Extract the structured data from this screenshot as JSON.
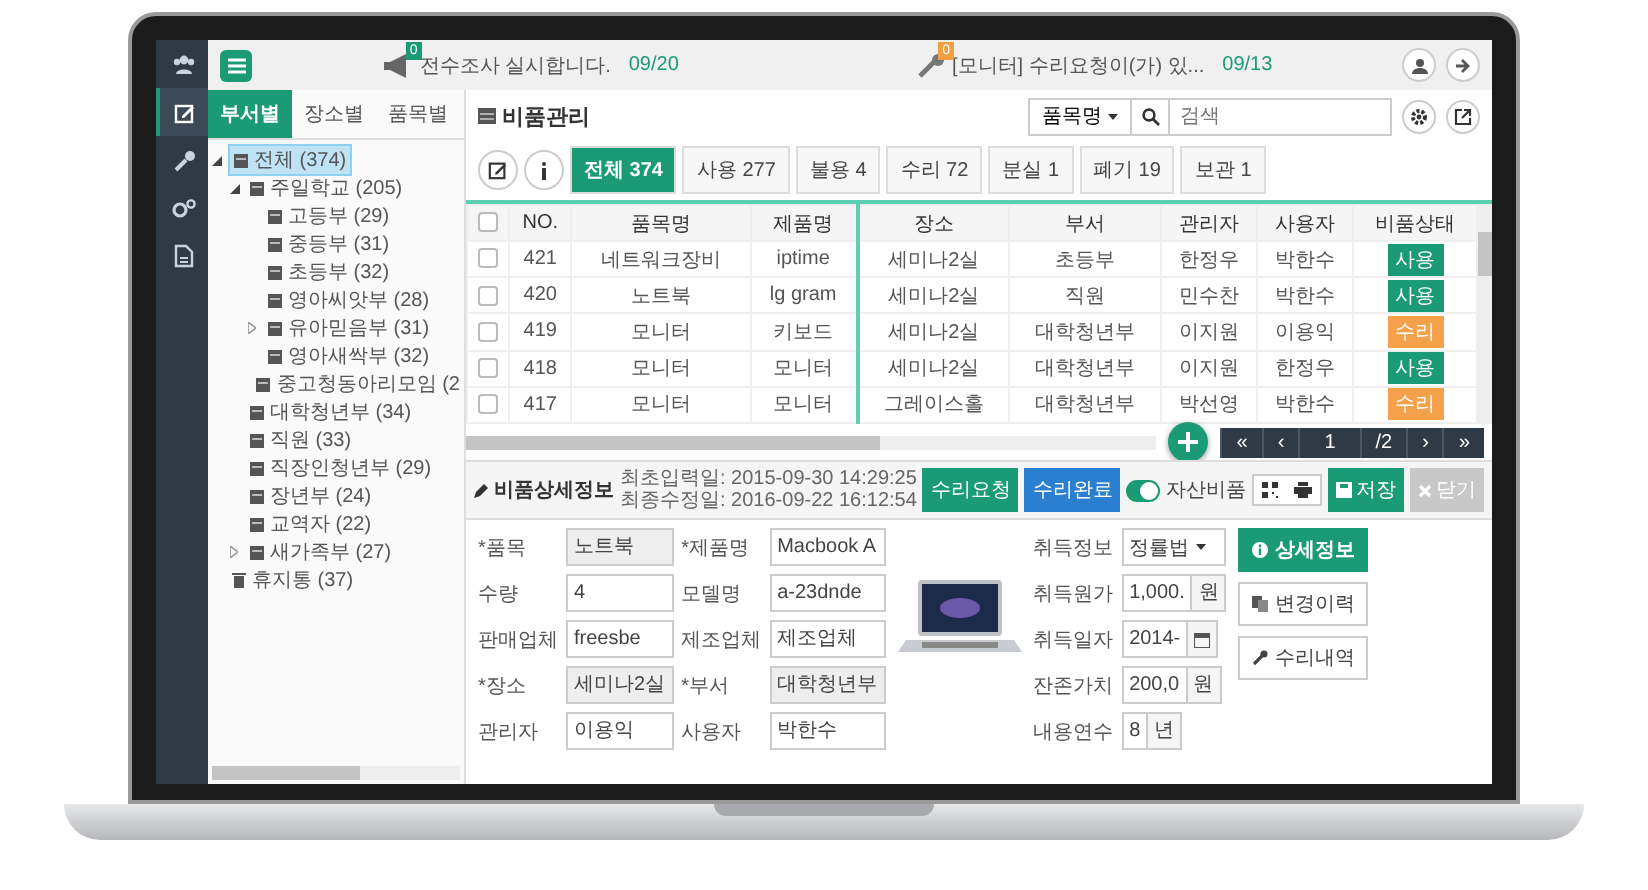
{
  "rail": {
    "items": [
      {
        "kind": "users",
        "selected": false
      },
      {
        "kind": "edit",
        "selected": true
      },
      {
        "kind": "wrench",
        "selected": false
      },
      {
        "kind": "gears",
        "selected": false
      },
      {
        "kind": "document",
        "selected": false
      }
    ]
  },
  "topbar": {
    "notices": [
      {
        "kind": "megaphone",
        "badge": "0",
        "color": "#1a9b76",
        "text": "전수조사 실시합니다.",
        "date": "09/20"
      },
      {
        "kind": "wrench",
        "badge": "0",
        "color": "#f0a040",
        "text": "[모니터] 수리요청이(가) 있...",
        "date": "09/13"
      }
    ]
  },
  "side_tabs": [
    {
      "label": "부서별",
      "selected": true
    },
    {
      "label": "장소별",
      "selected": false
    },
    {
      "label": "품목별",
      "selected": false
    }
  ],
  "tree": [
    {
      "label": "전체 (374)",
      "kind": "folder",
      "expanded": true,
      "selected": true,
      "children": [
        {
          "label": "주일학교 (205)",
          "kind": "folder",
          "expanded": true,
          "selected": false,
          "children": [
            {
              "label": "고등부 (29)",
              "kind": "folder",
              "selected": false
            },
            {
              "label": "중등부 (31)",
              "kind": "folder",
              "selected": false
            },
            {
              "label": "초등부 (32)",
              "kind": "folder",
              "selected": false
            },
            {
              "label": "영아씨앗부 (28)",
              "kind": "folder",
              "selected": false
            },
            {
              "label": "유아믿음부 (31)",
              "kind": "folder",
              "expanded": false,
              "selected": false
            },
            {
              "label": "영아새싹부 (32)",
              "kind": "folder",
              "selected": false
            },
            {
              "label": "중고청동아리모임 (2",
              "kind": "folder",
              "selected": false
            }
          ]
        },
        {
          "label": "대학청년부 (34)",
          "kind": "folder",
          "selected": false
        },
        {
          "label": "직원 (33)",
          "kind": "folder",
          "selected": false
        },
        {
          "label": "직장인청년부 (29)",
          "kind": "folder",
          "selected": false
        },
        {
          "label": "장년부 (24)",
          "kind": "folder",
          "selected": false
        },
        {
          "label": "교역자 (22)",
          "kind": "folder",
          "selected": false
        },
        {
          "label": "새가족부 (27)",
          "kind": "folder",
          "expanded": false,
          "selected": false
        }
      ]
    },
    {
      "label": "휴지통 (37)",
      "kind": "trash",
      "selected": false
    }
  ],
  "header": {
    "title": "비품관리",
    "search_by": "품목명",
    "search": {
      "placeholder": "검색"
    }
  },
  "filters": [
    {
      "label": "전체 374",
      "selected": true
    },
    {
      "label": "사용 277",
      "selected": false
    },
    {
      "label": "불용 4",
      "selected": false
    },
    {
      "label": "수리 72",
      "selected": false
    },
    {
      "label": "분실 1",
      "selected": false
    },
    {
      "label": "폐기 19",
      "selected": false
    },
    {
      "label": "보관 1",
      "selected": false
    }
  ],
  "table": {
    "select_all_checked": false,
    "columns": [
      "NO.",
      "품목명",
      "제품명",
      "장소",
      "부서",
      "관리자",
      "사용자",
      "비품상태"
    ],
    "rows": [
      {
        "checked": false,
        "cells": [
          "421",
          "네트워크장비",
          "iptime",
          "세미나2실",
          "초등부",
          "한정우",
          "박한수"
        ],
        "status": "사용",
        "color": "#1a9b76"
      },
      {
        "checked": false,
        "cells": [
          "420",
          "노트북",
          "lg gram",
          "세미나2실",
          "직원",
          "민수찬",
          "박한수"
        ],
        "status": "사용",
        "color": "#1a9b76"
      },
      {
        "checked": false,
        "cells": [
          "419",
          "모니터",
          "키보드",
          "세미나2실",
          "대학청년부",
          "이지원",
          "이용익"
        ],
        "status": "수리",
        "color": "#f5a04a"
      },
      {
        "checked": false,
        "cells": [
          "418",
          "모니터",
          "모니터",
          "세미나2실",
          "대학청년부",
          "이지원",
          "한정우"
        ],
        "status": "사용",
        "color": "#1a9b76"
      },
      {
        "checked": false,
        "cells": [
          "417",
          "모니터",
          "모니터",
          "그레이스홀",
          "대학청년부",
          "박선영",
          "박한수"
        ],
        "status": "수리",
        "color": "#f5a04a"
      }
    ]
  },
  "pagination": [
    {
      "label": "«",
      "kind": "button"
    },
    {
      "label": "‹",
      "kind": "button"
    },
    {
      "label": "1",
      "kind": "field"
    },
    {
      "label": "/2",
      "kind": "text"
    },
    {
      "label": "›",
      "kind": "button"
    },
    {
      "label": "»",
      "kind": "button"
    }
  ],
  "detail": {
    "title": "비품상세정보",
    "created": "최초입력일: 2015-09-30 14:29:25",
    "modified": "최종수정일: 2016-09-22 16:12:54",
    "actions": [
      {
        "label": "수리요청",
        "kind": "green"
      },
      {
        "label": "수리완료",
        "kind": "blue"
      }
    ],
    "asset_toggle": {
      "label": "자산비품",
      "on": true
    },
    "save": {
      "label": "저장",
      "disabled": false
    },
    "close": {
      "label": "닫기",
      "disabled": true
    },
    "fields": [
      {
        "label": "*품목",
        "value": "노트북",
        "readonly": true
      },
      {
        "label": "*제품명",
        "value": "Macbook A",
        "readonly": false
      },
      {
        "label": "수량",
        "value": "4",
        "readonly": false
      },
      {
        "label": "모델명",
        "value": "a-23dnde",
        "readonly": false
      },
      {
        "label": "판매업체",
        "value": "freesbe",
        "readonly": false
      },
      {
        "label": "제조업체",
        "value": "제조업체",
        "readonly": false
      },
      {
        "label": "*장소",
        "value": "세미나2실",
        "readonly": true
      },
      {
        "label": "*부서",
        "value": "대학청년부",
        "readonly": true
      },
      {
        "label": "관리자",
        "value": "이용익",
        "readonly": false
      },
      {
        "label": "사용자",
        "value": "박한수",
        "readonly": false
      }
    ],
    "acquisition": [
      {
        "label": "취득정보",
        "kind": "select",
        "value": "정률법"
      },
      {
        "label": "취득원가",
        "kind": "unit",
        "value": "1,000.",
        "unit": "원"
      },
      {
        "label": "취득일자",
        "kind": "date",
        "value": "2014-"
      },
      {
        "label": "잔존가치",
        "kind": "unit",
        "value": "200,0",
        "unit": "원"
      },
      {
        "label": "내용연수",
        "kind": "unit",
        "value": "8",
        "unit": "년"
      }
    ],
    "side_buttons": [
      {
        "label": "상세정보",
        "kind": "info",
        "primary": true
      },
      {
        "label": "변경이력",
        "kind": "copy",
        "primary": false
      },
      {
        "label": "수리내역",
        "kind": "wrench",
        "primary": false
      }
    ]
  }
}
